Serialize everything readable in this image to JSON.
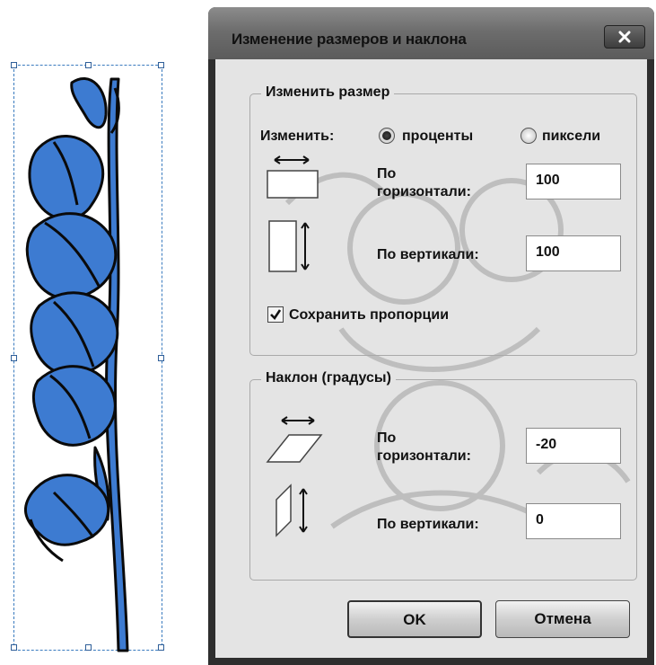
{
  "dialog": {
    "title": "Изменение размеров и наклона"
  },
  "resize": {
    "group_label": "Изменить размер",
    "by_label": "Изменить:",
    "option_percent": "проценты",
    "option_pixels": "пиксели",
    "selected_option": "percent",
    "horizontal_label_line1": "По",
    "horizontal_label_line2": "горизонтали:",
    "horizontal_value": "100",
    "vertical_label": "По вертикали:",
    "vertical_value": "100",
    "keep_ratio_label": "Сохранить пропорции",
    "keep_ratio_checked": true
  },
  "skew": {
    "group_label": "Наклон (градусы)",
    "horizontal_label_line1": "По",
    "horizontal_label_line2": "горизонтали:",
    "horizontal_value": "-20",
    "vertical_label": "По вертикали:",
    "vertical_value": "0"
  },
  "buttons": {
    "ok_label": "OK",
    "cancel_label": "Отмена"
  },
  "icons": {
    "close": "close-icon",
    "resize_horizontal": "resize-horizontal-icon",
    "resize_vertical": "resize-vertical-icon",
    "skew_horizontal": "skew-horizontal-icon",
    "skew_vertical": "skew-vertical-icon"
  },
  "colors": {
    "flower_fill": "#3d7bd1",
    "selection_border": "#3a7bbf",
    "dialog_frame": "#2e2e2e",
    "dialog_body": "#e4e4e4"
  }
}
